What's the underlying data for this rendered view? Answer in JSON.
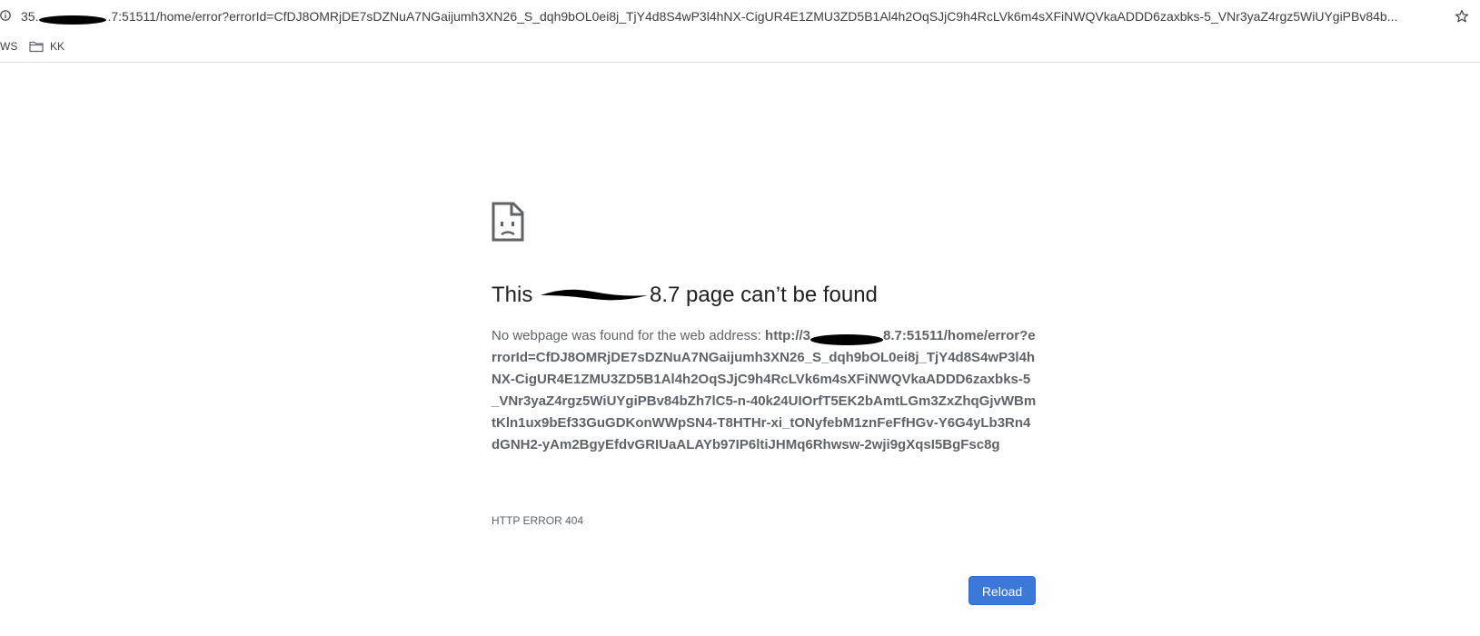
{
  "address_bar": {
    "url_prefix": "35.",
    "url_suffix": ".7:51511/home/error?errorId=CfDJ8OMRjDE7sDZNuA7NGaijumh3XN26_S_dqh9bOL0ei8j_TjY4d8S4wP3l4hNX-CigUR4E1ZMU3ZD5B1Al4h2OqSJjC9h4RcLVk6m4sXFiNWQVkaADDD6zaxbks-5_VNr3yaZ4rgz5WiUYgiPBv84b...",
    "info_icon": "info-icon",
    "bookmark_icon": "star-icon"
  },
  "bookmarks": {
    "items": [
      {
        "label": "WS"
      },
      {
        "label": "KK",
        "icon": "folder-icon"
      }
    ]
  },
  "error": {
    "icon": "sad-page-icon",
    "title_prefix": "This ",
    "title_suffix": "8.7 page can’t be found",
    "desc_prefix": "No webpage was found for the web address: ",
    "url_start": "http://3",
    "url_end": "8.7:51511/home/error?errorId=CfDJ8OMRjDE7sDZNuA7NGaijumh3XN26_S_dqh9bOL0ei8j_TjY4d8S4wP3l4hNX-CigUR4E1ZMU3ZD5B1Al4h2OqSJjC9h4RcLVk6m4sXFiNWQVkaADDD6zaxbks-5_VNr3yaZ4rgz5WiUYgiPBv84bZh7lC5-n-40k24UIOrfT5EK2bAmtLGm3ZxZhqGjvWBmtKln1ux9bEf33GuGDKonWWpSN4-T8HTHr-xi_tONyfebM1znFeFfHGv-Y6G4yLb3Rn4dGNH2-yAm2BgyEfdvGRIUaALAYb97IP6ltiJHMq6Rhwsw-2wji9gXqsI5BgFsc8g",
    "code": "HTTP ERROR 404"
  },
  "reload": {
    "label": "Reload",
    "color": "#3c78d8"
  }
}
